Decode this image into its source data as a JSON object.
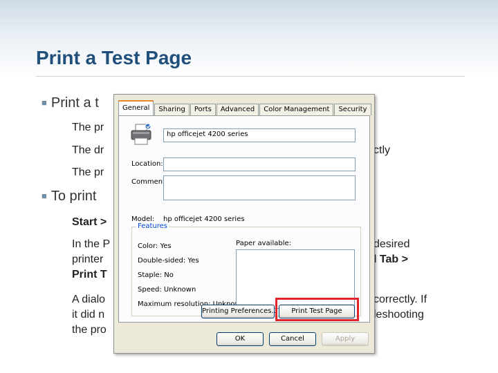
{
  "slide": {
    "title": "Print a Test Page",
    "bullet1": "Print a t",
    "sub1": "The pr",
    "sub2_start": "The dr",
    "sub2_end": "ctly",
    "sub3": "The pr",
    "bullet2": "To print",
    "step1": "Start >",
    "step2_line1_start": "In the P",
    "step2_line1_end": "desired",
    "step2_line2_start": "printer",
    "step2_line2_end": "l Tab >",
    "step2_line3": "Print T",
    "step3_line1_start": "A dialo",
    "step3_line1_end": "correctly. If",
    "step3_line2_start": "it did n",
    "step3_line2_end": "leshooting",
    "step3_line3": "the pro"
  },
  "dialog": {
    "tabs": [
      "General",
      "Sharing",
      "Ports",
      "Advanced",
      "Color Management",
      "Security"
    ],
    "active_tab": "General",
    "printer_name": "hp officejet 4200 series",
    "location_label": "Location:",
    "location_value": "",
    "comment_label": "Comment:",
    "comment_value": "",
    "model_label": "Model:",
    "model_value": "hp officejet 4200 series",
    "features_label": "Features",
    "features": {
      "color": "Color: Yes",
      "double_sided": "Double-sided: Yes",
      "staple": "Staple: No",
      "speed": "Speed: Unknown",
      "max_resolution": "Maximum resolution: Unknown"
    },
    "paper_available_label": "Paper available:",
    "printing_preferences_button": "Printing Preferences...",
    "print_test_page_button": "Print Test Page",
    "ok_button": "OK",
    "cancel_button": "Cancel",
    "apply_button": "Apply"
  },
  "colors": {
    "title": "#1f4f7a",
    "highlight": "#e0242a"
  }
}
